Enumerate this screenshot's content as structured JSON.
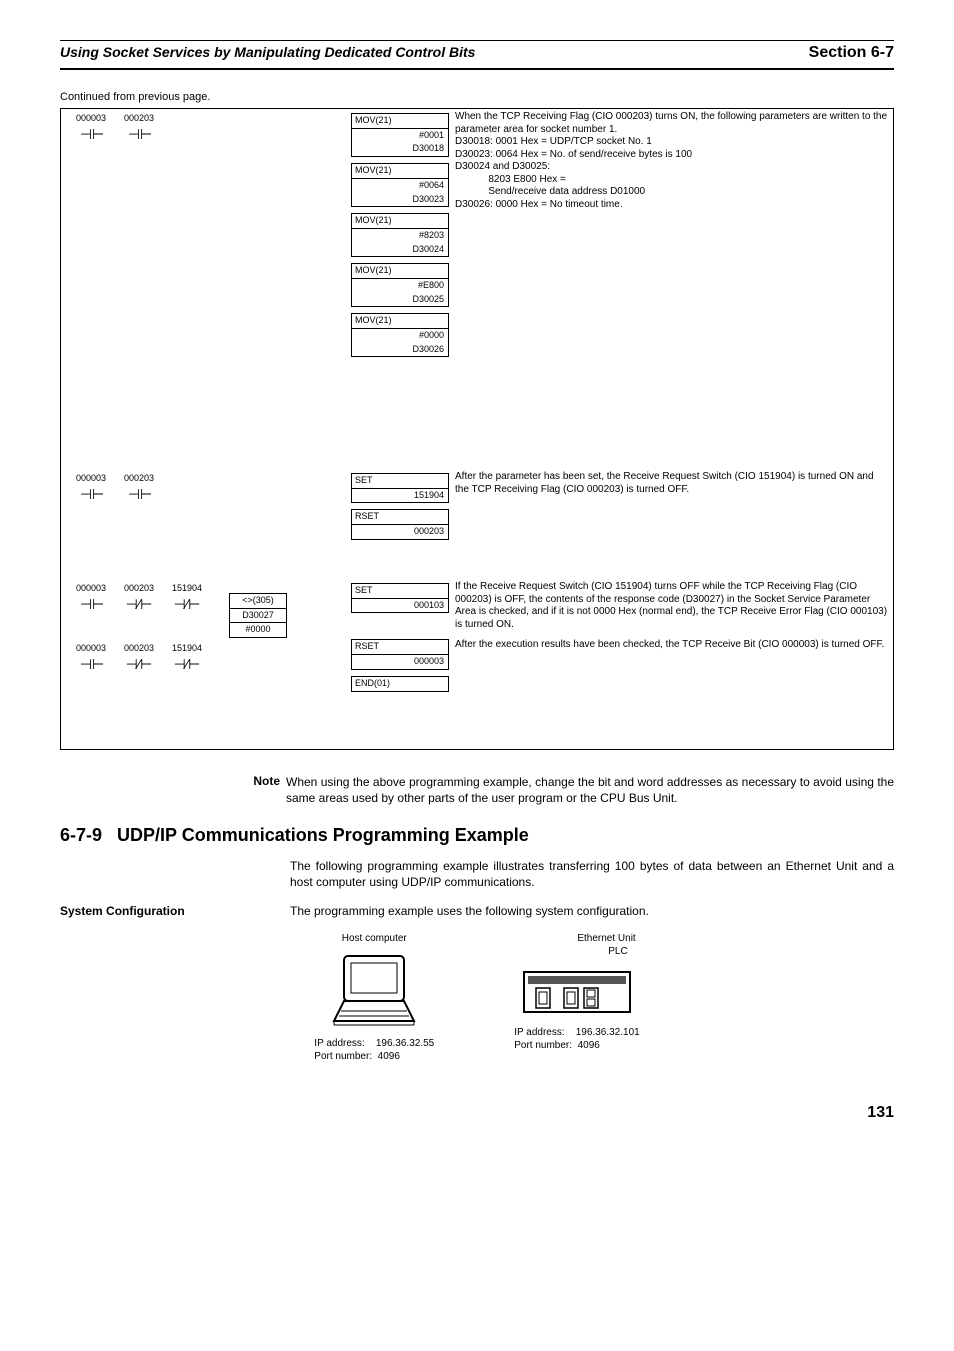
{
  "header": {
    "left": "Using Socket Services by Manipulating Dedicated Control Bits",
    "right": "Section 6-7"
  },
  "continued": "Continued from previous page.",
  "rung1": {
    "contacts": [
      "000003",
      "000203"
    ],
    "instructions": [
      {
        "op": "MOV(21)",
        "args": [
          "#0001",
          "D30018"
        ]
      },
      {
        "op": "MOV(21)",
        "args": [
          "#0064",
          "D30023"
        ]
      },
      {
        "op": "MOV(21)",
        "args": [
          "#8203",
          "D30024"
        ]
      },
      {
        "op": "MOV(21)",
        "args": [
          "#E800",
          "D30025"
        ]
      },
      {
        "op": "MOV(21)",
        "args": [
          "#0000",
          "D30026"
        ]
      }
    ],
    "desc_lines": [
      "When the TCP Receiving Flag (CIO 000203) turns ON, the following parameters are written to the parameter area for socket number 1.",
      "D30018: 0001 Hex = UDP/TCP socket No. 1",
      "D30023: 0064 Hex = No. of send/receive bytes is 100",
      "D30024 and D30025:",
      "            8203 E800 Hex =",
      "            Send/receive data address D01000",
      "D30026: 0000 Hex = No timeout time."
    ]
  },
  "rung2": {
    "contacts": [
      "000003",
      "000203"
    ],
    "instructions": [
      {
        "op": "SET",
        "args": [
          "151904"
        ]
      },
      {
        "op": "RSET",
        "args": [
          "000203"
        ]
      }
    ],
    "desc": "After the parameter has been set, the Receive Request Switch (CIO 151904) is turned ON and the TCP Receiving Flag (CIO 000203) is turned OFF."
  },
  "rung3": {
    "contacts_a": [
      "000003",
      "000203",
      "151904"
    ],
    "contacts_b": [
      "000003",
      "000203",
      "151904"
    ],
    "cmp": {
      "op": "<>(305)",
      "a": "D30027",
      "b": "#0000"
    },
    "instructions": [
      {
        "op": "SET",
        "args": [
          "000103"
        ]
      },
      {
        "op": "RSET",
        "args": [
          "000003"
        ]
      },
      {
        "op": "END(01)",
        "args": []
      }
    ],
    "desc1": "If the Receive Request Switch (CIO 151904) turns OFF while the TCP Receiving Flag (CIO 000203) is OFF, the contents of the response code (D30027) in the Socket Service Parameter Area is checked, and if it is not 0000 Hex (normal end), the TCP Receive Error Flag (CIO 000103) is turned ON.",
    "desc2": "After the execution results have been checked, the TCP Receive Bit (CIO 000003) is turned OFF."
  },
  "note": {
    "label": "Note",
    "text": "When using the above programming example, change the bit and word addresses as necessary to avoid using the same areas used by other parts of the user program or the CPU Bus Unit."
  },
  "section": {
    "num": "6-7-9",
    "title": "UDP/IP Communications Programming Example",
    "para": "The following programming example illustrates transferring 100 bytes of data between an Ethernet Unit and a host computer using UDP/IP communications."
  },
  "config": {
    "label": "System Configuration",
    "text": "The programming example uses the following system configuration.",
    "host_label": "Host computer",
    "eth_label": "Ethernet Unit",
    "plc_label": "PLC",
    "host_ip_label": "IP address:",
    "host_ip": "196.36.32.55",
    "host_port_label": "Port number:",
    "host_port": "4096",
    "plc_ip_label": "IP address:",
    "plc_ip": "196.36.32.101",
    "plc_port_label": "Port number:",
    "plc_port": "4096"
  },
  "page": "131"
}
